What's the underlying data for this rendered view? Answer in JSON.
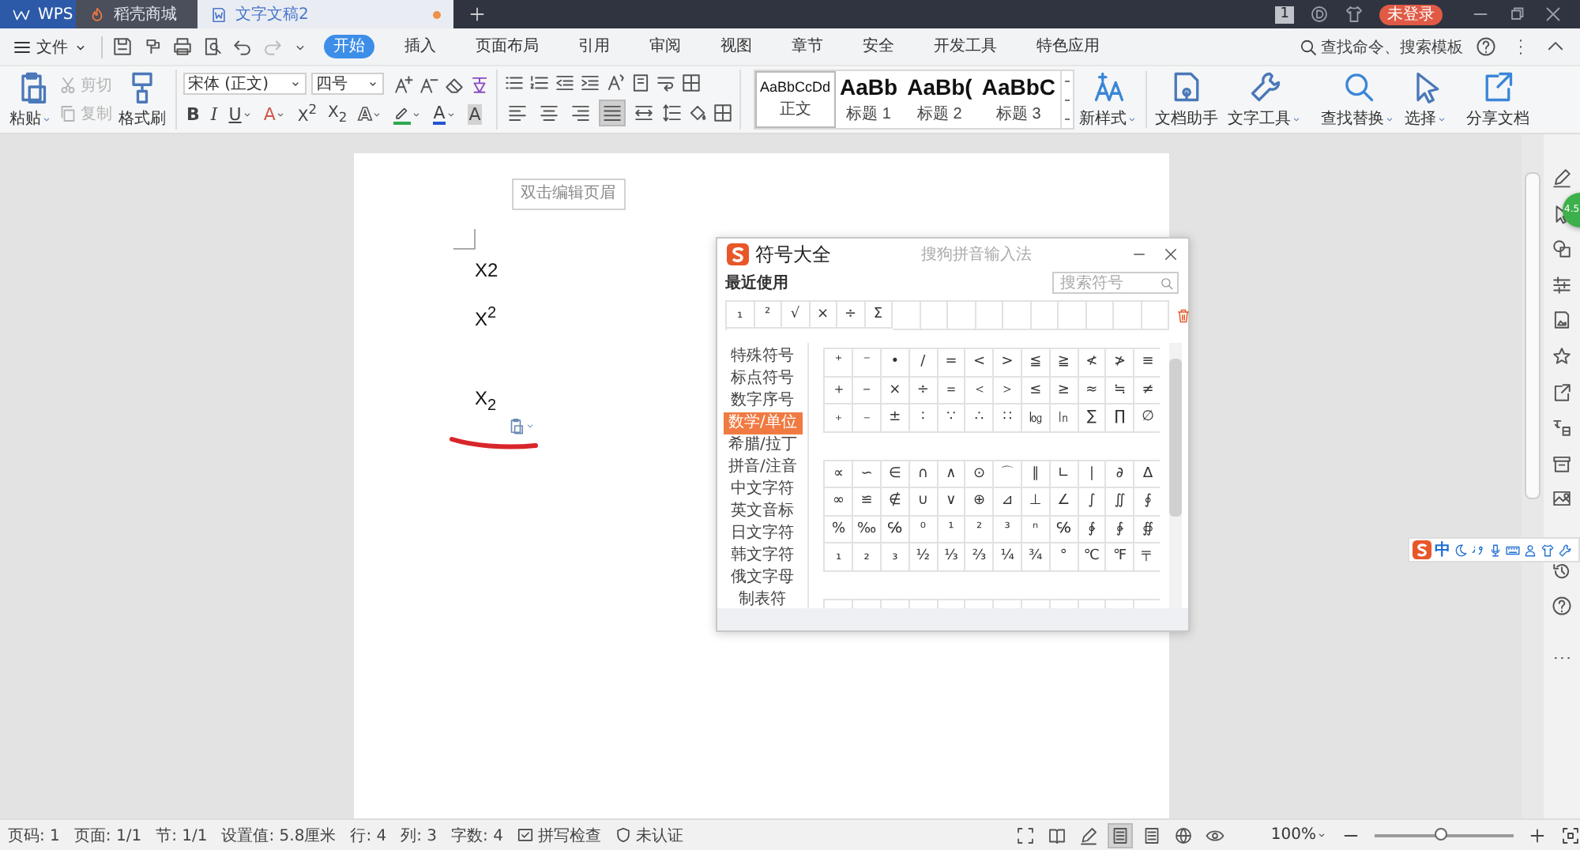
{
  "titlebar": {
    "tabs": [
      {
        "label": "WPS",
        "kind": "home",
        "selected": false,
        "unsaved": false
      },
      {
        "label": "稻壳商城",
        "kind": "store",
        "selected": false,
        "unsaved": false
      },
      {
        "label": "文字文稿2",
        "kind": "doc",
        "selected": true,
        "unsaved": true
      }
    ],
    "badge": "1",
    "login": "未登录"
  },
  "menu": {
    "file": "文件",
    "tabs": [
      {
        "label": "开始",
        "selected": true
      },
      {
        "label": "插入",
        "selected": false
      },
      {
        "label": "页面布局",
        "selected": false
      },
      {
        "label": "引用",
        "selected": false
      },
      {
        "label": "审阅",
        "selected": false
      },
      {
        "label": "视图",
        "selected": false
      },
      {
        "label": "章节",
        "selected": false
      },
      {
        "label": "安全",
        "selected": false
      },
      {
        "label": "开发工具",
        "selected": false
      },
      {
        "label": "特色应用",
        "selected": false
      }
    ],
    "search": "查找命令、搜索模板"
  },
  "ribbon": {
    "paste": "粘贴",
    "cut": {
      "label": "剪切",
      "disabled": true
    },
    "copy": {
      "label": "复制",
      "disabled": true
    },
    "format_painter": "格式刷",
    "font": "宋体 (正文)",
    "size": "四号",
    "format_buttons": [
      {
        "kind": "bold",
        "label": "B",
        "dropdown": false
      },
      {
        "kind": "italic",
        "label": "I",
        "dropdown": false
      },
      {
        "kind": "underline",
        "label": "U",
        "dropdown": true
      },
      {
        "kind": "effect",
        "label": "A",
        "dropdown": true
      },
      {
        "kind": "superscript",
        "label": "X$^{2}$",
        "dropdown": false
      },
      {
        "kind": "subscript",
        "label": "X$_{2}$",
        "dropdown": false
      },
      {
        "kind": "outline",
        "label": "A",
        "dropdown": true
      },
      {
        "kind": "highlight",
        "dropdown": true
      },
      {
        "kind": "color",
        "label": "A",
        "dropdown": true
      },
      {
        "kind": "shade",
        "label": "A",
        "dropdown": false
      }
    ],
    "align_buttons": [
      {
        "kind": "left",
        "selected": false
      },
      {
        "kind": "center",
        "selected": false
      },
      {
        "kind": "right",
        "selected": false
      },
      {
        "kind": "justify",
        "selected": true
      },
      {
        "kind": "distribute",
        "selected": false
      }
    ],
    "styles": [
      {
        "preview": "AaBbCcDd",
        "label": "正文",
        "selected": true
      },
      {
        "preview": "AaBb",
        "label": "标题 1",
        "selected": false
      },
      {
        "preview": "AaBb(",
        "label": "标题 2",
        "selected": false
      },
      {
        "preview": "AaBbC",
        "label": "标题 3",
        "selected": false
      }
    ],
    "new_style": "新样式",
    "tools": [
      {
        "label": "文档助手",
        "dropdown": false
      },
      {
        "label": "文字工具",
        "dropdown": true
      },
      {
        "label": "查找替换",
        "dropdown": true
      },
      {
        "label": "选择",
        "dropdown": true
      },
      {
        "label": "分享文档",
        "dropdown": false
      }
    ]
  },
  "document": {
    "header_hint": "双击编辑页眉",
    "lines": [
      {
        "text": "X2"
      },
      {
        "text": "X$^{2}$"
      },
      {
        "text": "X$_{2}$"
      }
    ]
  },
  "dialog": {
    "title": "符号大全",
    "subtitle": "搜狗拼音输入法",
    "recent_label": "最近使用",
    "search_placeholder": "搜索符号",
    "recent": [
      "₁",
      "²",
      "√",
      "×",
      "÷",
      "Σ"
    ],
    "categories": [
      {
        "label": "特殊符号",
        "selected": false
      },
      {
        "label": "标点符号",
        "selected": false
      },
      {
        "label": "数字序号",
        "selected": false
      },
      {
        "label": "数学/单位",
        "selected": true
      },
      {
        "label": "希腊/拉丁",
        "selected": false
      },
      {
        "label": "拼音/注音",
        "selected": false
      },
      {
        "label": "中文字符",
        "selected": false
      },
      {
        "label": "英文音标",
        "selected": false
      },
      {
        "label": "日文字符",
        "selected": false
      },
      {
        "label": "韩文字符",
        "selected": false
      },
      {
        "label": "俄文字母",
        "selected": false
      },
      {
        "label": "制表符",
        "selected": false
      }
    ],
    "groups": [
      [
        [
          "⁺",
          "⁻",
          "•",
          "/",
          "=",
          "<",
          ">",
          "≦",
          "≧",
          "≮",
          "≯",
          "≡"
        ],
        [
          "＋",
          "－",
          "×",
          "÷",
          "＝",
          "＜",
          "＞",
          "≤",
          "≥",
          "≈",
          "≒",
          "≠"
        ],
        [
          "₊",
          "₋",
          "±",
          "∶",
          "∵",
          "∴",
          "∷",
          "㏒",
          "㏑",
          "∑",
          "∏",
          "∅"
        ]
      ],
      [
        [
          "∝",
          "∽",
          "∈",
          "∩",
          "∧",
          "⊙",
          "⌒",
          "∥",
          "∟",
          "∣",
          "∂",
          "∆"
        ],
        [
          "∞",
          "≌",
          "∉",
          "∪",
          "∨",
          "⊕",
          "⊿",
          "⊥",
          "∠",
          "∫",
          "∬",
          "∮"
        ],
        [
          "%",
          "‰",
          "℅",
          "⁰",
          "¹",
          "²",
          "³",
          "ⁿ",
          "℅",
          "∲",
          "∳",
          "∯"
        ],
        [
          "₁",
          "₂",
          "₃",
          "½",
          "⅓",
          "⅔",
          "¼",
          "¾",
          "°",
          "℃",
          "℉",
          "〒"
        ]
      ]
    ]
  },
  "ime": {
    "label": "中"
  },
  "floating_ball": {
    "label": "4.5"
  },
  "status_bar": {
    "items": [
      "页码: 1",
      "页面: 1/1",
      "节: 1/1",
      "设置值: 5.8厘米",
      "行: 4",
      "列: 3",
      "字数: 4"
    ],
    "spell_check": "拼写检查",
    "certification": "未认证",
    "view_modes": [
      {
        "selected": false
      },
      {
        "selected": false
      },
      {
        "selected": false
      },
      {
        "selected": true
      },
      {
        "selected": false
      },
      {
        "selected": false
      },
      {
        "selected": false
      }
    ],
    "zoom": "100%",
    "zoom_slider": {
      "level": 0.48
    }
  }
}
